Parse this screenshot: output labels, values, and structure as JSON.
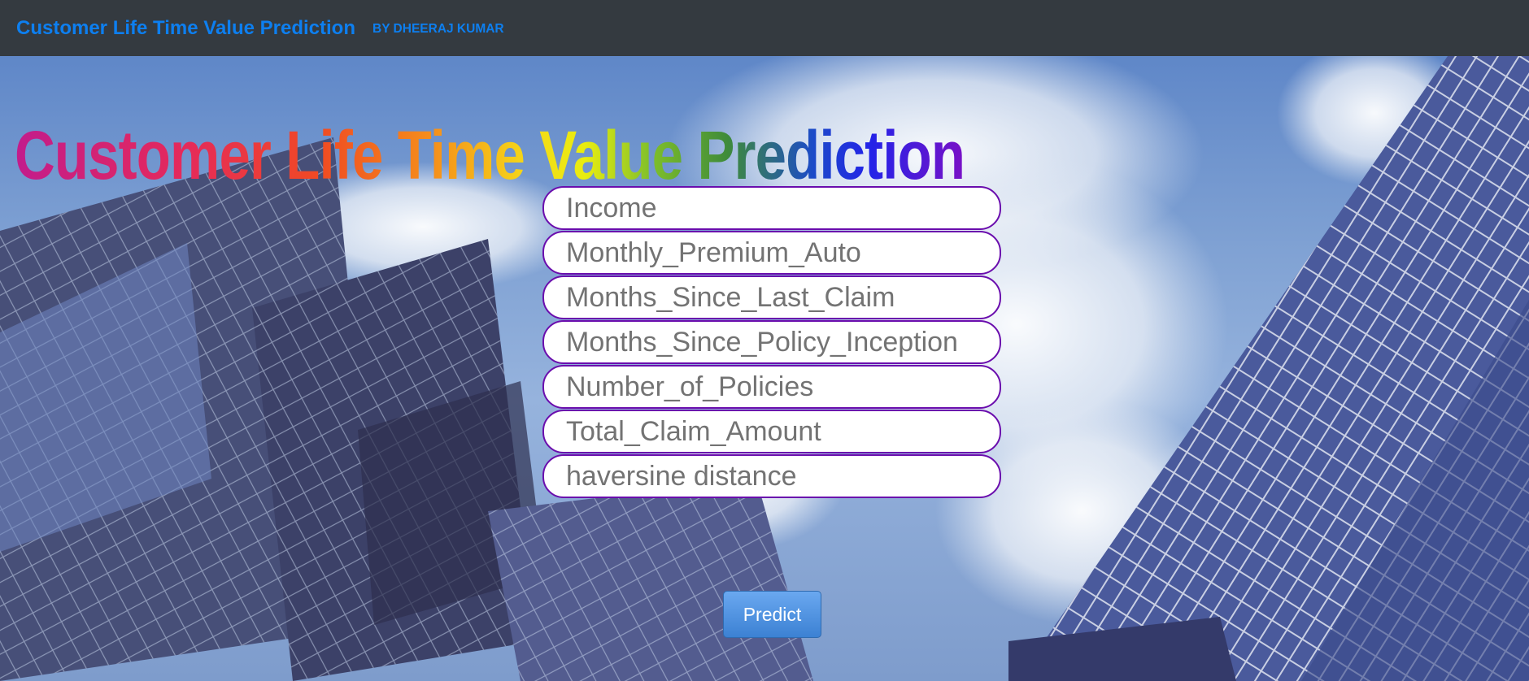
{
  "navbar": {
    "brand": "Customer Life Time Value Prediction",
    "byline": "BY DHEERAJ KUMAR"
  },
  "hero": {
    "headline": "Customer Life Time Value Prediction",
    "background": "glass-skyscrapers-against-cloudy-sky"
  },
  "form": {
    "fields": [
      {
        "placeholder": "Income"
      },
      {
        "placeholder": "Monthly_Premium_Auto"
      },
      {
        "placeholder": "Months_Since_Last_Claim"
      },
      {
        "placeholder": "Months_Since_Policy_Inception"
      },
      {
        "placeholder": "Number_of_Policies"
      },
      {
        "placeholder": "Total_Claim_Amount"
      },
      {
        "placeholder": "haversine distance"
      }
    ],
    "submit_label": "Predict"
  },
  "colors": {
    "navbar_bg": "#343a40",
    "brand": "#0d7ff0",
    "field_border": "#6a0dad",
    "button": "#3c81d3"
  }
}
